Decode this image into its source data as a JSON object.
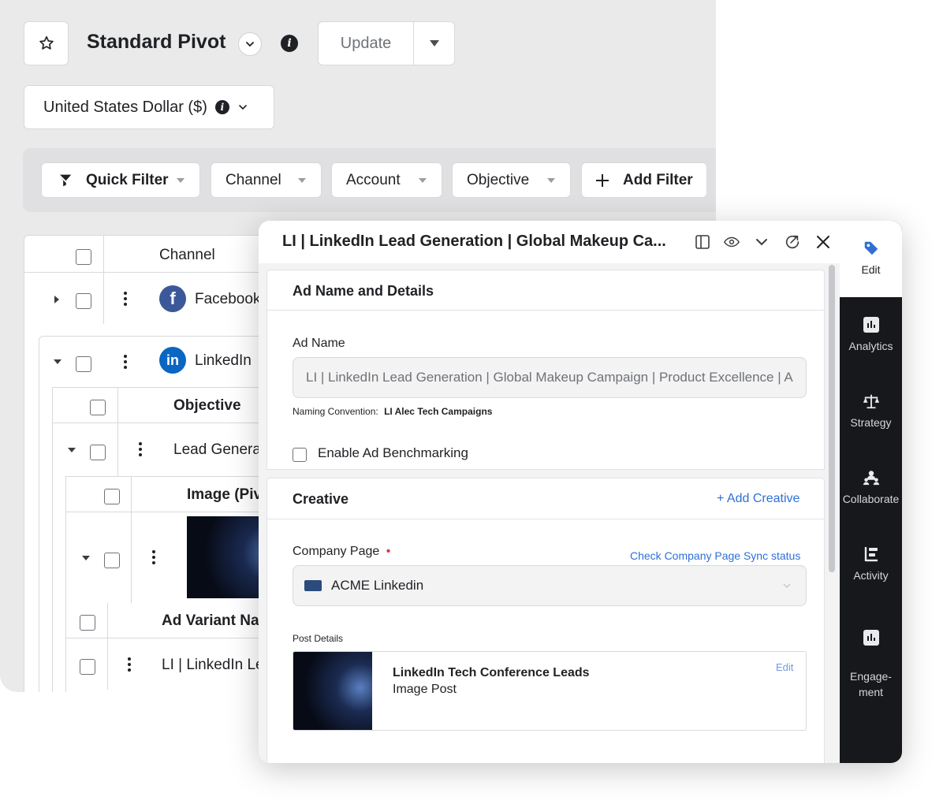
{
  "report": {
    "title": "Standard Pivot",
    "update_label": "Update",
    "currency": "United States Dollar ($)"
  },
  "filters": {
    "quick_filter": "Quick Filter",
    "channel": "Channel",
    "account": "Account",
    "objective": "Objective",
    "add_filter": "Add Filter"
  },
  "table": {
    "channel_header": "Channel",
    "rows": {
      "facebook": "Facebook",
      "linkedin": "LinkedIn"
    },
    "objective_header": "Objective",
    "objective_row": "Lead Genera",
    "image_header": "Image (Pivo",
    "ad_variant_header": "Ad Variant Nam",
    "ad_variant_row": "LI | LinkedIn Le"
  },
  "panel": {
    "title": "LI | LinkedIn Lead Generation | Global Makeup Ca...",
    "section_ad_details": "Ad Name and Details",
    "ad_name_label": "Ad Name",
    "ad_name_value": "LI | LinkedIn Lead Generation | Global Makeup Campaign | Product Excellence | A",
    "naming_convention_label": "Naming Convention:",
    "naming_convention_value": "LI Alec Tech Campaigns",
    "benchmark_label": "Enable Ad Benchmarking",
    "section_creative": "Creative",
    "add_creative": "+ Add Creative",
    "company_page_label": "Company Page",
    "check_sync": "Check Company Page Sync status",
    "company_page_value": "ACME Linkedin",
    "post_details_label": "Post Details",
    "post_title": "LinkedIn Tech Conference Leads",
    "post_type": "Image Post",
    "post_edit": "Edit"
  },
  "sidebar": {
    "items": [
      {
        "label": "Edit",
        "icon": "tag-icon"
      },
      {
        "label": "Analytics",
        "icon": "bar-chart-icon"
      },
      {
        "label": "Strategy",
        "icon": "scale-icon"
      },
      {
        "label": "Collaborate",
        "icon": "people-icon"
      },
      {
        "label": "Activity",
        "icon": "activity-icon"
      },
      {
        "label": "Engage-\nment",
        "icon": "engagement-chart-icon"
      }
    ]
  },
  "colors": {
    "accent": "#2f6fd6",
    "facebook": "#3b5998",
    "linkedin": "#0a66c2",
    "required": "#e0334d",
    "sidebar_bg": "#16181b"
  }
}
